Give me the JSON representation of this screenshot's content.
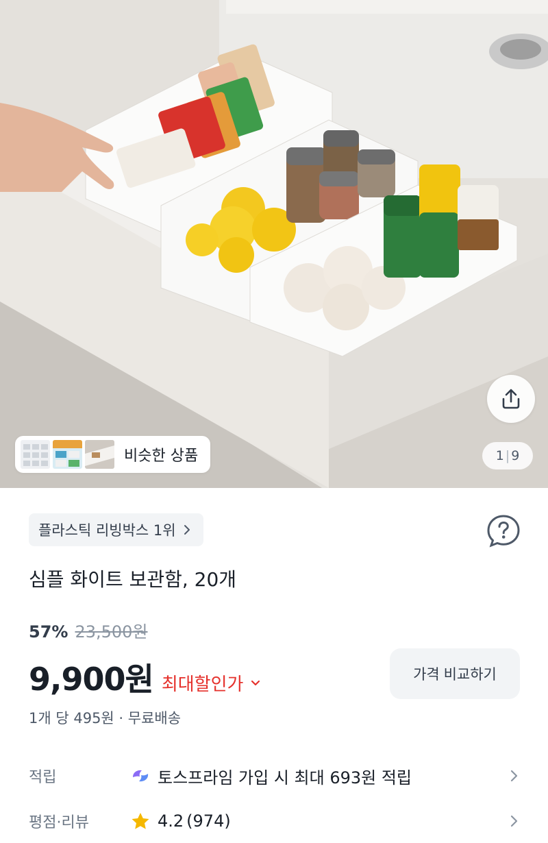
{
  "hero": {
    "similar_label": "비슷한 상품",
    "counter_current": "1",
    "counter_total": "9"
  },
  "product": {
    "rank_badge": "플라스틱 리빙박스 1위",
    "title": "심플 화이트 보관함, 20개",
    "discount_rate": "57%",
    "original_price": "23,500원",
    "price": "9,900원",
    "best_price_label": "최대할인가",
    "compare_button": "가격 비교하기",
    "unit_info": "1개 당 495원 · 무료배송"
  },
  "rows": {
    "points_label": "적립",
    "points_value": "토스프라임 가입 시 최대 693원 적립",
    "review_label": "평점·리뷰",
    "rating": "4.2",
    "review_count": "(974)"
  },
  "colors": {
    "accent_red": "#e5312c",
    "chip_bg": "#f2f4f6",
    "star": "#f5b800",
    "prime_icon": "#8b6cf5"
  },
  "icons": [
    "share-icon",
    "help-icon",
    "chevron-right-icon",
    "chevron-down-icon",
    "star-icon",
    "toss-prime-icon"
  ]
}
